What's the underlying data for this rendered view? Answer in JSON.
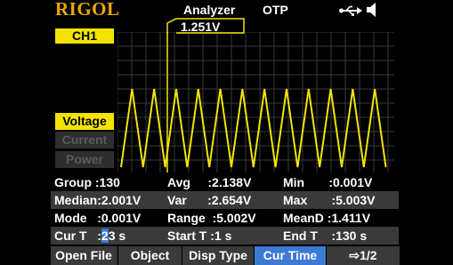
{
  "header": {
    "logo": "RIGOL",
    "mode": "Analyzer",
    "status": "OTP"
  },
  "channel": "CH1",
  "cursor_readout": "1.251V",
  "types": [
    "Voltage",
    "Current",
    "Power"
  ],
  "selected_type": "Voltage",
  "stats": {
    "row0": {
      "c1": "Group :130",
      "c2": "Avg     :2.138V",
      "c3": "Min       :0.001V"
    },
    "row1": {
      "c1": "Median:2.001V",
      "c2": "Var      :2.654V",
      "c3": "Max       :5.003V"
    },
    "row2": {
      "c1": "Mode   :0.001V",
      "c2": "Range  :5.002V",
      "c3": "MeanD :1.411V"
    },
    "row3": {
      "c1_prefix": "Cur T   :",
      "c1_digit": "2",
      "c1_suffix": "3 s",
      "c2": "Start T :1 s",
      "c3": "End T    :130 s"
    }
  },
  "menu": [
    "Open File",
    "Object",
    "Disp Type",
    "Cur Time",
    "⇨1/2"
  ],
  "active_menu": "Cur Time",
  "colors": {
    "waveform": "#f2e400",
    "accent": "#3c7ad6",
    "logo": "#e8a800"
  },
  "icons": [
    "usb-icon",
    "speaker-icon"
  ],
  "waveform": {
    "cycles": 12.3,
    "min_v": 0.001,
    "max_v": 5.003,
    "cursor_time_s": 23
  }
}
